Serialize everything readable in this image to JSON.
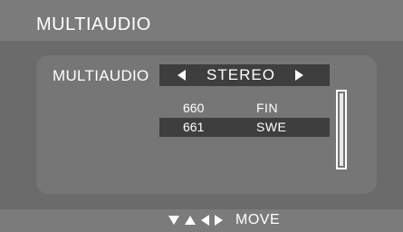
{
  "header": {
    "title": "MULTIAUDIO"
  },
  "panel": {
    "label": "MULTIAUDIO",
    "selector": {
      "value": "STEREO",
      "left_icon": "arrow-left-icon",
      "right_icon": "arrow-right-icon"
    },
    "tracks": [
      {
        "number": "660",
        "language": "FIN",
        "selected": false
      },
      {
        "number": "661",
        "language": "SWE",
        "selected": true
      }
    ]
  },
  "footer": {
    "icons": [
      "arrow-down-icon",
      "arrow-up-icon",
      "arrow-left-icon",
      "arrow-right-icon"
    ],
    "hint": "MOVE"
  },
  "colors": {
    "background": "#6b6b6b",
    "bars": "#7b7b7b",
    "panel": "#767676",
    "highlight": "#3e3e3e",
    "text": "#ffffff"
  }
}
